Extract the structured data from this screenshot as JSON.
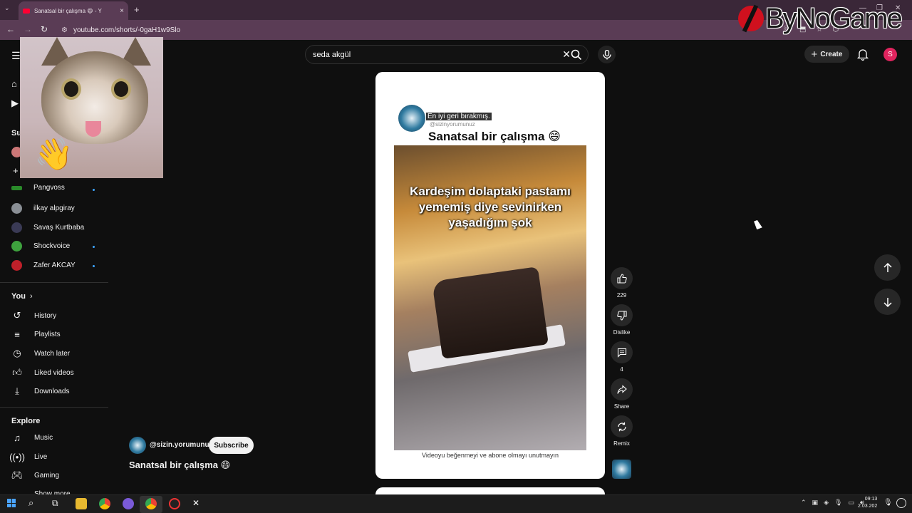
{
  "browser": {
    "tab_title": "Sanatsal bir çalışma 😄 - Y",
    "new_tab": "+",
    "url": "youtube.com/shorts/-0gaH1w9Slo",
    "window_controls": [
      "—",
      "❐",
      "✕"
    ]
  },
  "watermark": {
    "text": "ByNoGame"
  },
  "header": {
    "search_value": "seda akgül",
    "create_label": "Create",
    "avatar_initial": "S"
  },
  "sidebar": {
    "subscriptions_heading_partial": "Su",
    "subscriptions": [
      {
        "name": "Pangvoss",
        "new": true,
        "color": "#2a8a2a"
      },
      {
        "name": "ilkay alpgiray",
        "new": false,
        "color": "#8a8f95"
      },
      {
        "name": "Savaş Kurtbaba",
        "new": false,
        "color": "#3a3a55"
      },
      {
        "name": "Shockvoice",
        "new": true,
        "color": "#3ea23e"
      },
      {
        "name": "Zafer AKCAY",
        "new": true,
        "color": "#c0202a"
      }
    ],
    "you_heading": "You",
    "you_items": [
      {
        "label": "History",
        "icon": "history-icon"
      },
      {
        "label": "Playlists",
        "icon": "playlists-icon"
      },
      {
        "label": "Watch later",
        "icon": "clock-icon"
      },
      {
        "label": "Liked videos",
        "icon": "thumb-up-icon"
      },
      {
        "label": "Downloads",
        "icon": "download-icon"
      }
    ],
    "explore_heading": "Explore",
    "explore_items": [
      {
        "label": "Music",
        "icon": "music-icon"
      },
      {
        "label": "Live",
        "icon": "live-icon"
      },
      {
        "label": "Gaming",
        "icon": "gaming-icon"
      }
    ],
    "show_more": "Show more"
  },
  "video": {
    "caption_highlight": "En iyi geri bırakmış.",
    "handle": "@sizinyorumunuz",
    "title_in_video": "Sanatsal bir çalışma 😄",
    "overlay_text": "Kardeşim dolaptaki pastamı yememiş diye sevinirken yaşadığım şok",
    "footer_text": "Videoyu beğenmeyi ve abone olmayı unutmayın"
  },
  "channel": {
    "name": "@sizin.yorumunuz",
    "subscribe_label": "Subscribe",
    "short_title": "Sanatsal bir çalışma 😄"
  },
  "actions": {
    "like_count": "229",
    "dislike_label": "Dislike",
    "comment_count": "4",
    "share_label": "Share",
    "remix_label": "Remix"
  },
  "taskbar": {
    "time": "09:13",
    "date": "2.03.202"
  }
}
